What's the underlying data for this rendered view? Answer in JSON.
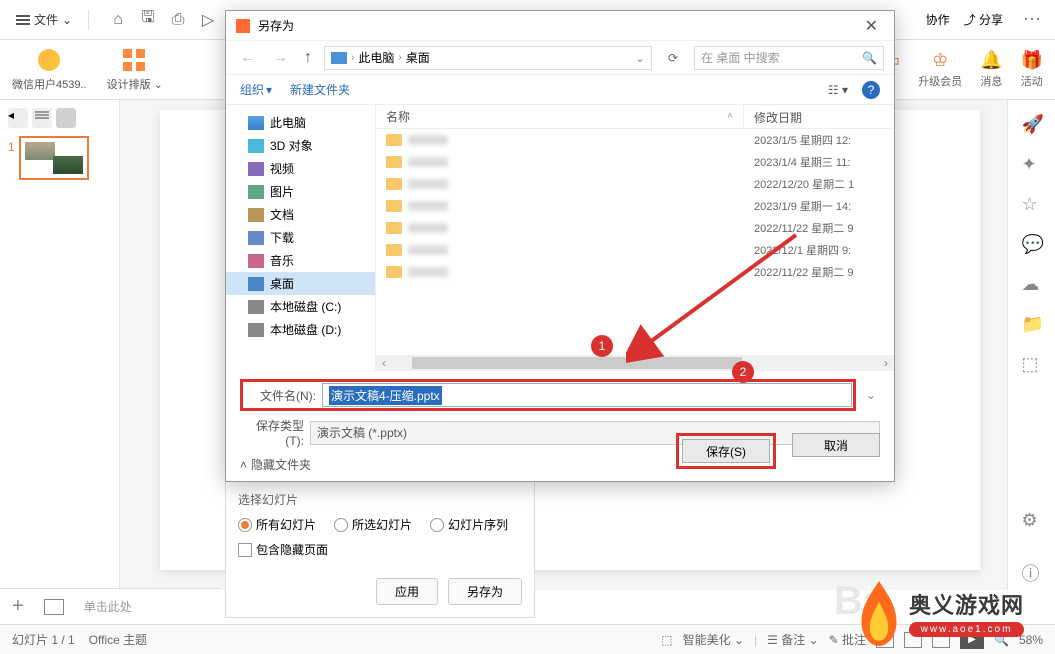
{
  "toolbar": {
    "file_menu": "文件",
    "coop": "协作",
    "share": "分享"
  },
  "sub_toolbar": {
    "wechat_user": "微信用户4539..",
    "design_layout": "设计排版",
    "upgrade": "升级会员",
    "message": "消息",
    "activity": "活动"
  },
  "thumbs": {
    "slide1_num": "1"
  },
  "dialog": {
    "title": "另存为",
    "path_pc": "此电脑",
    "path_desktop": "桌面",
    "search_placeholder": "在 桌面 中搜索",
    "organize": "组织",
    "new_folder": "新建文件夹",
    "col_name": "名称",
    "col_date": "修改日期",
    "tree": {
      "pc": "此电脑",
      "objects3d": "3D 对象",
      "video": "视频",
      "pic": "图片",
      "doc": "文档",
      "download": "下载",
      "music": "音乐",
      "desktop": "桌面",
      "diskc": "本地磁盘 (C:)",
      "diskd": "本地磁盘 (D:)"
    },
    "files": [
      {
        "date": "2023/1/5 星期四 12:"
      },
      {
        "date": "2023/1/4 星期三 11:"
      },
      {
        "date": "2022/12/20 星期二 1"
      },
      {
        "date": "2023/1/9 星期一 14:"
      },
      {
        "date": "2022/11/22 星期二 9"
      },
      {
        "date": "2022/12/1 星期四 9:"
      },
      {
        "date": "2022/11/22 星期二 9"
      }
    ],
    "filename_label": "文件名(N):",
    "filename_value": "演示文稿4-压缩.pptx",
    "savetype_label": "保存类型(T):",
    "savetype_value": "演示文稿 (*.pptx)",
    "hide_folders": "隐藏文件夹",
    "save_btn": "保存(S)",
    "cancel_btn": "取消",
    "marker1": "1",
    "marker2": "2"
  },
  "options": {
    "select_slides": "选择幻灯片",
    "all_slides": "所有幻灯片",
    "selected_slides": "所选幻灯片",
    "slide_sequence": "幻灯片序列",
    "include_hidden": "包含隐藏页面",
    "apply": "应用",
    "save_as": "另存为"
  },
  "add_bar": {
    "placeholder": "单击此处"
  },
  "status": {
    "slide_pos": "幻灯片 1 / 1",
    "theme": "Office 主题",
    "smart_beautify": "智能美化",
    "remarks": "备注",
    "review": "批注",
    "zoom": "58%"
  },
  "logo": {
    "cn": "奥义游戏网",
    "url": "www.aoe1.com"
  }
}
